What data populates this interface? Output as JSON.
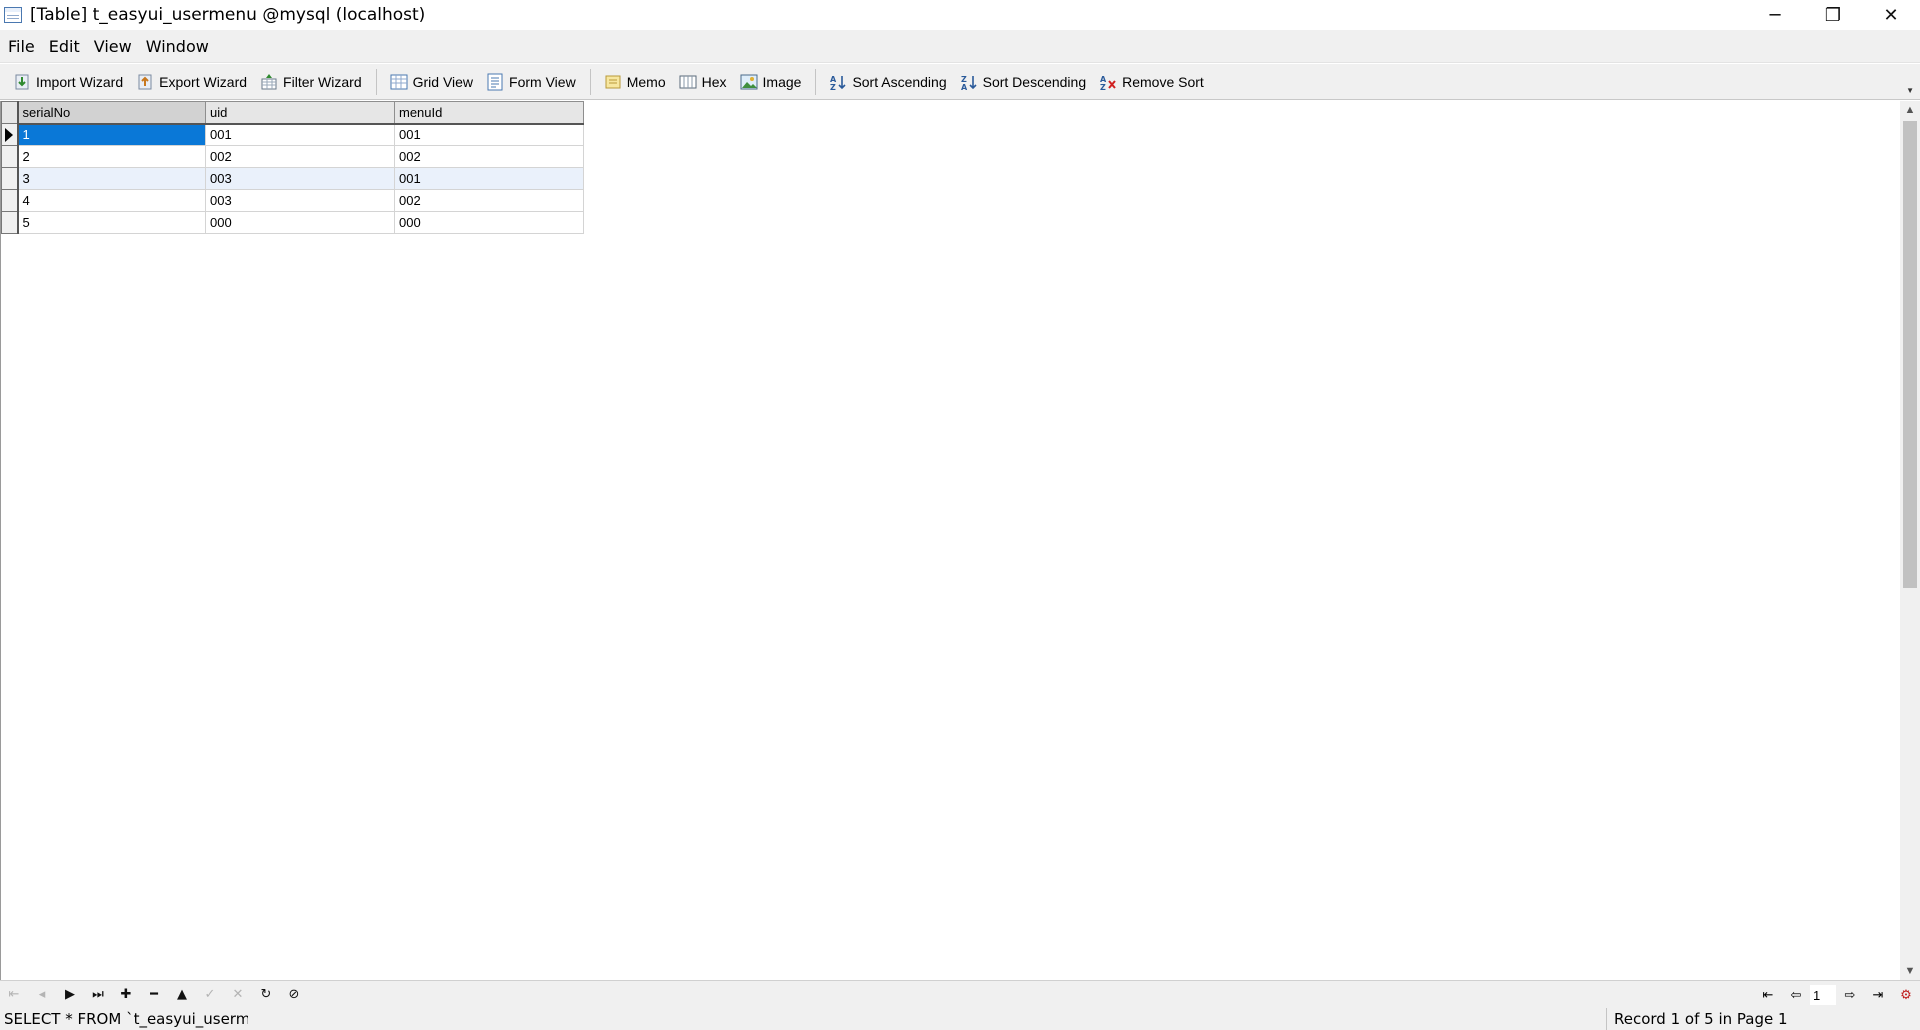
{
  "window": {
    "title": "[Table] t_easyui_usermenu @mysql (localhost)",
    "minimize_glyph": "─",
    "restore_glyph": "❐",
    "close_glyph": "✕"
  },
  "menu": [
    "File",
    "Edit",
    "View",
    "Window"
  ],
  "toolbar": {
    "import_wizard": "Import Wizard",
    "export_wizard": "Export Wizard",
    "filter_wizard": "Filter Wizard",
    "grid_view": "Grid View",
    "form_view": "Form View",
    "memo": "Memo",
    "hex": "Hex",
    "image": "Image",
    "sort_ascending": "Sort Ascending",
    "sort_descending": "Sort Descending",
    "remove_sort": "Remove Sort"
  },
  "grid": {
    "columns": [
      "serialNo",
      "uid",
      "menuId"
    ],
    "rows": [
      [
        "1",
        "001",
        "001"
      ],
      [
        "2",
        "002",
        "002"
      ],
      [
        "3",
        "003",
        "001"
      ],
      [
        "4",
        "003",
        "002"
      ],
      [
        "5",
        "000",
        "000"
      ]
    ],
    "selected_row": 0
  },
  "pager": {
    "page_number": "1"
  },
  "status": {
    "sql": "SELECT * FROM `t_easyui_usermenu`",
    "record": "Record 1 of 5 in Page 1"
  },
  "colors": {
    "selection": "#0a78d7",
    "alt_row": "#eaf1fb",
    "chrome": "#f0f0f0"
  }
}
